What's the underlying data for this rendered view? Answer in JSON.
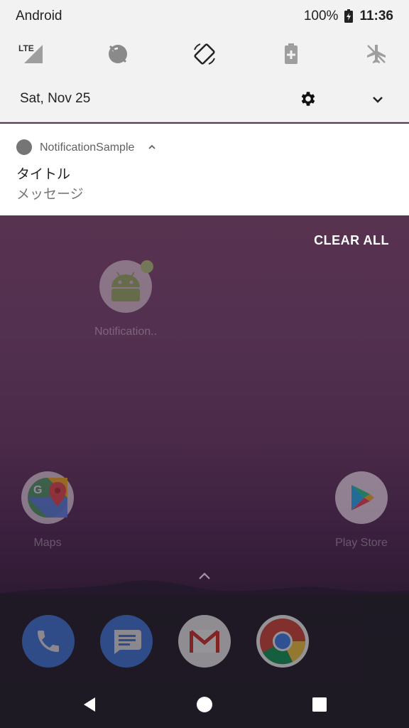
{
  "status_bar": {
    "carrier": "Android",
    "battery": "100%",
    "time": "11:36"
  },
  "quick_settings": {
    "tiles": [
      {
        "name": "lte-signal",
        "label": "LTE"
      },
      {
        "name": "data-saver-off",
        "label": ""
      },
      {
        "name": "auto-rotate",
        "label": ""
      },
      {
        "name": "battery-saver",
        "label": ""
      },
      {
        "name": "airplane-mode",
        "label": ""
      }
    ],
    "date": "Sat, Nov 25"
  },
  "notification": {
    "app_name": "NotificationSample",
    "title": "タイトル",
    "message": "メッセージ"
  },
  "clear_all_label": "CLEAR ALL",
  "home": {
    "apps": [
      {
        "label": "Notification.."
      },
      {
        "label": "Maps"
      },
      {
        "label": "Play Store"
      }
    ]
  },
  "colors": {
    "shade_bg": "#f2f2f2",
    "card_bg": "#ffffff",
    "wallpaper_top": "#5e3a4e",
    "dock_bg": "#1e1a24"
  }
}
